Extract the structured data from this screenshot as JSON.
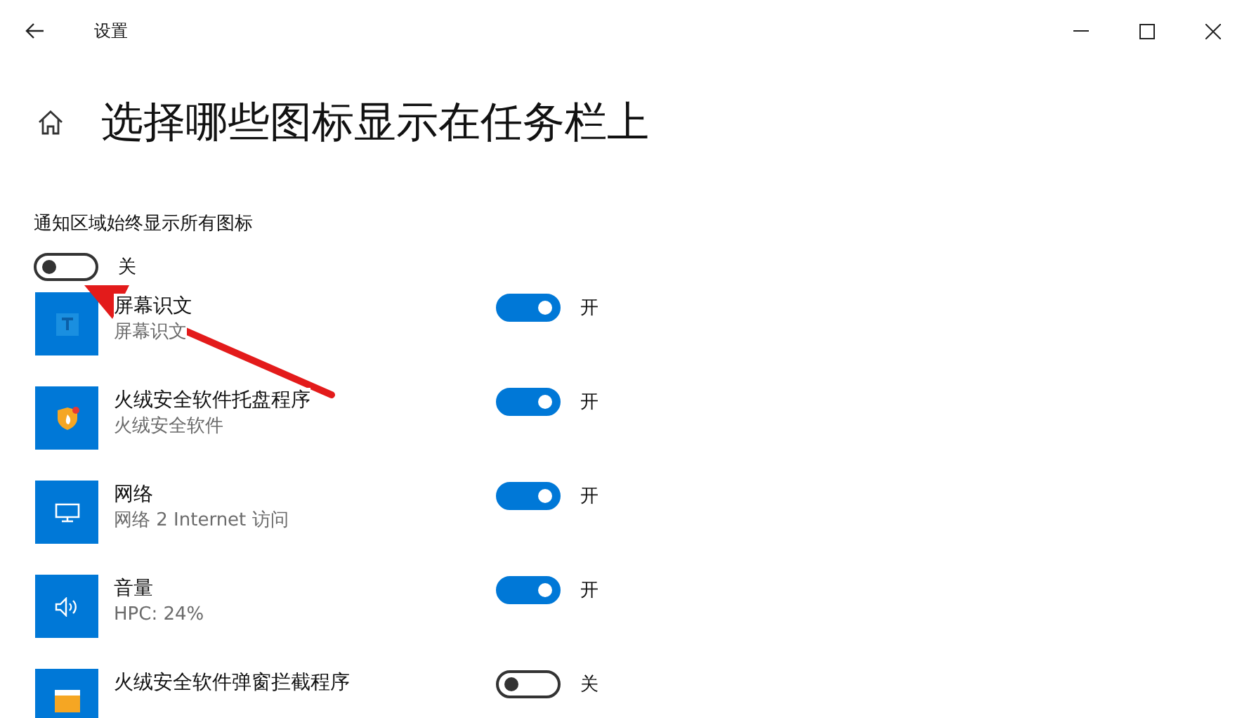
{
  "window": {
    "title": "设置"
  },
  "heading": "选择哪些图标显示在任务栏上",
  "always_show": {
    "label": "通知区域始终显示所有图标",
    "on": false,
    "state_text": "关"
  },
  "items": [
    {
      "kind": "text",
      "title": "屏幕识文",
      "subtitle": "屏幕识文",
      "on": true,
      "state_text": "开"
    },
    {
      "kind": "shield",
      "title": "火绒安全软件托盘程序",
      "subtitle": "火绒安全软件",
      "on": true,
      "state_text": "开"
    },
    {
      "kind": "network",
      "title": "网络",
      "subtitle": "网络 2 Internet 访问",
      "on": true,
      "state_text": "开"
    },
    {
      "kind": "volume",
      "title": "音量",
      "subtitle": "HPC: 24%",
      "on": true,
      "state_text": "开"
    },
    {
      "kind": "window",
      "title": "火绒安全软件弹窗拦截程序",
      "on": false,
      "state_text": "关"
    }
  ]
}
